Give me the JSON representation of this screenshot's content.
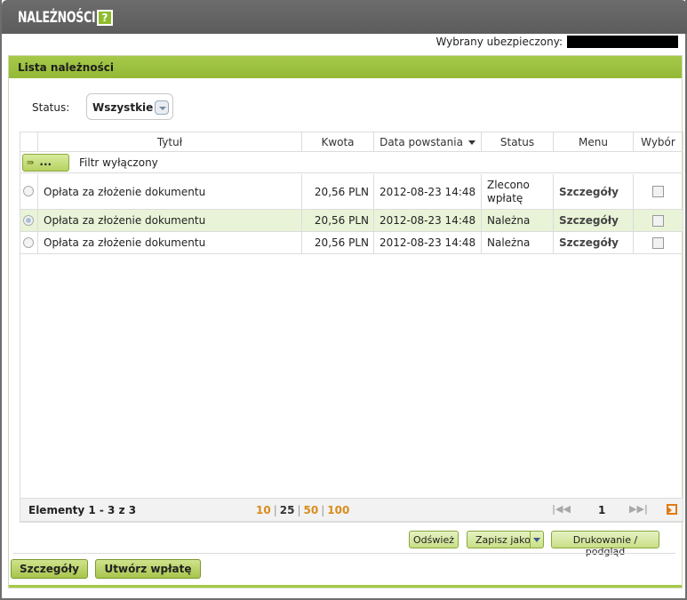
{
  "header": {
    "title": "NALEŻNOŚCI",
    "help_icon": "?"
  },
  "insured": {
    "label": "Wybrany ubezpieczony:"
  },
  "panel": {
    "title": "Lista należności"
  },
  "status_filter": {
    "label": "Status:",
    "value": "Wszystkie"
  },
  "table": {
    "columns": [
      "Tytuł",
      "Kwota",
      "Data powstania",
      "Status",
      "Menu",
      "Wybór"
    ],
    "filter_button": "...",
    "filter_text": "Filtr wyłączony",
    "rows": [
      {
        "title": "Opłata za złożenie dokumentu",
        "amount": "20,56 PLN",
        "date": "2012-08-23 14:48",
        "status": "Zlecono wpłatę",
        "menu": "Szczegóły",
        "selected": false
      },
      {
        "title": "Opłata za złożenie dokumentu",
        "amount": "20,56 PLN",
        "date": "2012-08-23 14:48",
        "status": "Należna",
        "menu": "Szczegóły",
        "selected": true
      },
      {
        "title": "Opłata za złożenie dokumentu",
        "amount": "20,56 PLN",
        "date": "2012-08-23 14:48",
        "status": "Należna",
        "menu": "Szczegóły",
        "selected": false
      }
    ]
  },
  "pager": {
    "elements": "Elementy 1 - 3 z 3",
    "page_sizes": [
      "10",
      "25",
      "50",
      "100"
    ],
    "current_page_size": "25",
    "current_page": "1"
  },
  "actions": {
    "refresh": "Odśwież",
    "save_as": "Zapisz jako",
    "print": "Drukowanie / podgląd",
    "details": "Szczegóły",
    "create_payment": "Utwórz wpłatę"
  },
  "colors": {
    "accent": "#a6c94a",
    "header": "#6c6c6c",
    "link_orange": "#d98c1c"
  }
}
